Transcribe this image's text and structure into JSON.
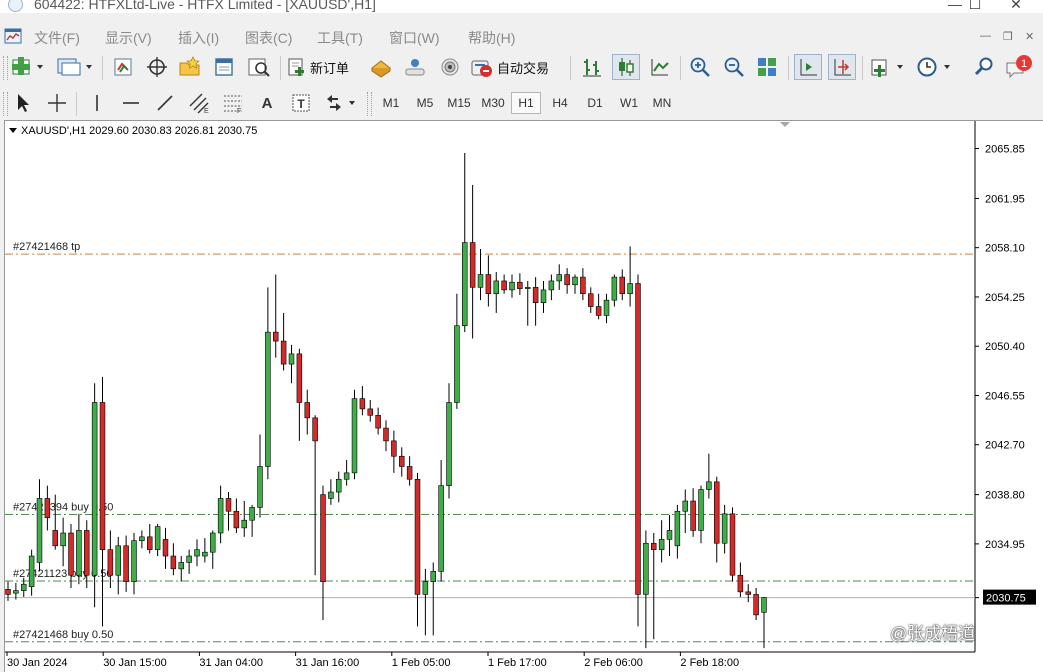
{
  "window": {
    "title": "604422: HTFXLtd-Live - HTFX Limited - [XAUUSD',H1]"
  },
  "menu": {
    "items": [
      "文件(F)",
      "显示(V)",
      "插入(I)",
      "图表(C)",
      "工具(T)",
      "窗口(W)",
      "帮助(H)"
    ]
  },
  "toolbar": {
    "new_order_label": "新订单",
    "auto_trading_label": "自动交易",
    "alerts_badge": "1"
  },
  "drawing_toolbar": {
    "text_tool": "A",
    "timeframes": [
      "M1",
      "M5",
      "M15",
      "M30",
      "H1",
      "H4",
      "D1",
      "W1",
      "MN"
    ],
    "active_timeframe": "H1"
  },
  "chart": {
    "header": "XAUUSD',H1  2029.60 2030.83 2026.81 2030.75",
    "current_price": "2030.75",
    "watermark": "@张成梧道",
    "colors": {
      "bull": "#3fae49",
      "bear": "#d42a2a",
      "trade_line": "#4b8f4b",
      "tp_line": "#d9813a",
      "bid_line": "#b0b0b0",
      "price_label_bg": "#000000"
    }
  },
  "chart_data": {
    "type": "candlestick",
    "symbol": "XAUUSD'",
    "timeframe": "H1",
    "ohlc_header": {
      "open": 2029.6,
      "high": 2030.83,
      "low": 2026.81,
      "close": 2030.75
    },
    "y_ticks": [
      2065.85,
      2061.95,
      2058.1,
      2054.25,
      2050.4,
      2046.55,
      2042.7,
      2038.8,
      2034.95,
      2030.75
    ],
    "ylim": [
      2026.5,
      2068.0
    ],
    "x_labels": [
      "30 Jan 2024",
      "30 Jan 15:00",
      "31 Jan 04:00",
      "31 Jan 16:00",
      "1 Feb 05:00",
      "1 Feb 17:00",
      "2 Feb 06:00",
      "2 Feb 18:00"
    ],
    "order_lines": [
      {
        "label": "#27421468 tp",
        "price": 2057.6,
        "style": "tp"
      },
      {
        "label": "#27421394 buy 0.50",
        "price": 2037.25,
        "style": "buy"
      },
      {
        "label": "#27421123 buy 0.50",
        "price": 2032.05,
        "style": "buy"
      },
      {
        "label": "#27421468 buy 0.50",
        "price": 2027.3,
        "style": "buy"
      }
    ],
    "candles": [
      {
        "o": 2031.4,
        "h": 2032.0,
        "l": 2030.5,
        "c": 2031.0
      },
      {
        "o": 2031.1,
        "h": 2031.9,
        "l": 2030.6,
        "c": 2031.3
      },
      {
        "o": 2031.3,
        "h": 2032.3,
        "l": 2030.8,
        "c": 2031.8
      },
      {
        "o": 2031.6,
        "h": 2034.5,
        "l": 2030.9,
        "c": 2034.0
      },
      {
        "o": 2033.5,
        "h": 2040.0,
        "l": 2032.8,
        "c": 2038.5
      },
      {
        "o": 2038.5,
        "h": 2039.5,
        "l": 2036.0,
        "c": 2037.0
      },
      {
        "o": 2036.0,
        "h": 2038.8,
        "l": 2034.5,
        "c": 2034.8
      },
      {
        "o": 2034.8,
        "h": 2037.0,
        "l": 2033.2,
        "c": 2035.8
      },
      {
        "o": 2035.8,
        "h": 2036.5,
        "l": 2031.5,
        "c": 2032.5
      },
      {
        "o": 2032.5,
        "h": 2037.3,
        "l": 2031.8,
        "c": 2036.0
      },
      {
        "o": 2036.0,
        "h": 2036.8,
        "l": 2031.5,
        "c": 2032.5
      },
      {
        "o": 2032.5,
        "h": 2047.5,
        "l": 2030.0,
        "c": 2046.0
      },
      {
        "o": 2046.0,
        "h": 2048.0,
        "l": 2028.5,
        "c": 2034.5
      },
      {
        "o": 2034.5,
        "h": 2036.0,
        "l": 2031.5,
        "c": 2032.5
      },
      {
        "o": 2032.5,
        "h": 2035.5,
        "l": 2031.0,
        "c": 2034.8
      },
      {
        "o": 2034.8,
        "h": 2035.6,
        "l": 2031.2,
        "c": 2032.0
      },
      {
        "o": 2032.0,
        "h": 2035.8,
        "l": 2031.0,
        "c": 2035.2
      },
      {
        "o": 2035.2,
        "h": 2036.0,
        "l": 2034.6,
        "c": 2035.5
      },
      {
        "o": 2035.5,
        "h": 2036.5,
        "l": 2034.2,
        "c": 2034.5
      },
      {
        "o": 2034.5,
        "h": 2036.5,
        "l": 2034.0,
        "c": 2036.3
      },
      {
        "o": 2035.3,
        "h": 2036.2,
        "l": 2033.0,
        "c": 2034.0
      },
      {
        "o": 2034.0,
        "h": 2035.0,
        "l": 2032.5,
        "c": 2033.0
      },
      {
        "o": 2033.0,
        "h": 2034.0,
        "l": 2032.0,
        "c": 2033.5
      },
      {
        "o": 2033.5,
        "h": 2034.5,
        "l": 2032.6,
        "c": 2034.0
      },
      {
        "o": 2034.0,
        "h": 2035.3,
        "l": 2033.2,
        "c": 2034.5
      },
      {
        "o": 2034.0,
        "h": 2035.4,
        "l": 2033.5,
        "c": 2034.3
      },
      {
        "o": 2034.3,
        "h": 2036.0,
        "l": 2033.0,
        "c": 2035.8
      },
      {
        "o": 2035.8,
        "h": 2039.5,
        "l": 2035.0,
        "c": 2038.5
      },
      {
        "o": 2038.5,
        "h": 2039.0,
        "l": 2036.0,
        "c": 2037.5
      },
      {
        "o": 2037.5,
        "h": 2038.5,
        "l": 2035.8,
        "c": 2036.2
      },
      {
        "o": 2036.2,
        "h": 2038.3,
        "l": 2035.5,
        "c": 2036.8
      },
      {
        "o": 2036.8,
        "h": 2038.0,
        "l": 2035.5,
        "c": 2037.8
      },
      {
        "o": 2037.8,
        "h": 2043.5,
        "l": 2037.0,
        "c": 2041.0
      },
      {
        "o": 2041.0,
        "h": 2055.0,
        "l": 2040.0,
        "c": 2051.5
      },
      {
        "o": 2051.5,
        "h": 2056.0,
        "l": 2049.5,
        "c": 2050.8
      },
      {
        "o": 2050.8,
        "h": 2053.0,
        "l": 2048.5,
        "c": 2049.0
      },
      {
        "o": 2049.0,
        "h": 2050.5,
        "l": 2047.5,
        "c": 2049.8
      },
      {
        "o": 2049.8,
        "h": 2050.2,
        "l": 2043.0,
        "c": 2046.0
      },
      {
        "o": 2046.0,
        "h": 2047.0,
        "l": 2043.5,
        "c": 2044.8
      },
      {
        "o": 2044.8,
        "h": 2045.0,
        "l": 2032.5,
        "c": 2043.0
      },
      {
        "o": 2038.8,
        "h": 2039.5,
        "l": 2029.0,
        "c": 2032.0
      },
      {
        "o": 2038.5,
        "h": 2040.0,
        "l": 2038.0,
        "c": 2039.0
      },
      {
        "o": 2039.0,
        "h": 2040.6,
        "l": 2038.2,
        "c": 2040.0
      },
      {
        "o": 2040.0,
        "h": 2041.5,
        "l": 2039.5,
        "c": 2040.5
      },
      {
        "o": 2040.5,
        "h": 2047.0,
        "l": 2040.0,
        "c": 2046.3
      },
      {
        "o": 2046.3,
        "h": 2047.3,
        "l": 2045.0,
        "c": 2045.5
      },
      {
        "o": 2045.5,
        "h": 2046.2,
        "l": 2044.5,
        "c": 2045.0
      },
      {
        "o": 2045.0,
        "h": 2045.6,
        "l": 2043.5,
        "c": 2044.0
      },
      {
        "o": 2044.0,
        "h": 2044.6,
        "l": 2042.2,
        "c": 2043.0
      },
      {
        "o": 2043.0,
        "h": 2043.8,
        "l": 2040.5,
        "c": 2041.8
      },
      {
        "o": 2041.8,
        "h": 2042.5,
        "l": 2040.2,
        "c": 2041.0
      },
      {
        "o": 2041.0,
        "h": 2041.8,
        "l": 2039.5,
        "c": 2040.0
      },
      {
        "o": 2040.0,
        "h": 2040.5,
        "l": 2028.5,
        "c": 2031.0
      },
      {
        "o": 2031.0,
        "h": 2033.0,
        "l": 2027.8,
        "c": 2032.0
      },
      {
        "o": 2032.0,
        "h": 2033.5,
        "l": 2027.8,
        "c": 2032.8
      },
      {
        "o": 2032.8,
        "h": 2041.5,
        "l": 2032.0,
        "c": 2039.5
      },
      {
        "o": 2039.5,
        "h": 2047.5,
        "l": 2038.5,
        "c": 2046.0
      },
      {
        "o": 2046.0,
        "h": 2054.5,
        "l": 2045.5,
        "c": 2052.0
      },
      {
        "o": 2052.0,
        "h": 2065.5,
        "l": 2051.5,
        "c": 2058.5
      },
      {
        "o": 2058.5,
        "h": 2063.0,
        "l": 2051.0,
        "c": 2055.0
      },
      {
        "o": 2055.0,
        "h": 2058.0,
        "l": 2054.0,
        "c": 2056.0
      },
      {
        "o": 2056.0,
        "h": 2057.5,
        "l": 2053.5,
        "c": 2054.5
      },
      {
        "o": 2054.5,
        "h": 2056.2,
        "l": 2053.0,
        "c": 2055.5
      },
      {
        "o": 2055.5,
        "h": 2056.0,
        "l": 2054.5,
        "c": 2054.8
      },
      {
        "o": 2054.8,
        "h": 2056.0,
        "l": 2054.2,
        "c": 2055.4
      },
      {
        "o": 2055.4,
        "h": 2056.1,
        "l": 2054.4,
        "c": 2054.9
      },
      {
        "o": 2054.9,
        "h": 2055.5,
        "l": 2052.0,
        "c": 2055.0
      },
      {
        "o": 2055.0,
        "h": 2055.8,
        "l": 2052.0,
        "c": 2053.8
      },
      {
        "o": 2053.8,
        "h": 2055.5,
        "l": 2053.0,
        "c": 2054.8
      },
      {
        "o": 2054.8,
        "h": 2056.0,
        "l": 2054.0,
        "c": 2055.5
      },
      {
        "o": 2055.5,
        "h": 2056.8,
        "l": 2054.8,
        "c": 2056.0
      },
      {
        "o": 2056.0,
        "h": 2056.5,
        "l": 2054.5,
        "c": 2055.2
      },
      {
        "o": 2055.2,
        "h": 2056.0,
        "l": 2054.5,
        "c": 2055.8
      },
      {
        "o": 2055.8,
        "h": 2056.5,
        "l": 2054.0,
        "c": 2054.5
      },
      {
        "o": 2054.5,
        "h": 2055.0,
        "l": 2053.0,
        "c": 2053.5
      },
      {
        "o": 2053.5,
        "h": 2054.5,
        "l": 2052.5,
        "c": 2052.8
      },
      {
        "o": 2052.8,
        "h": 2054.5,
        "l": 2052.2,
        "c": 2054.0
      },
      {
        "o": 2054.0,
        "h": 2056.0,
        "l": 2053.5,
        "c": 2055.8
      },
      {
        "o": 2055.8,
        "h": 2056.4,
        "l": 2054.0,
        "c": 2054.5
      },
      {
        "o": 2054.5,
        "h": 2058.2,
        "l": 2053.5,
        "c": 2055.3
      },
      {
        "o": 2055.3,
        "h": 2056.0,
        "l": 2028.5,
        "c": 2031.0
      },
      {
        "o": 2031.0,
        "h": 2036.0,
        "l": 2026.8,
        "c": 2035.0
      },
      {
        "o": 2035.0,
        "h": 2035.8,
        "l": 2027.5,
        "c": 2034.5
      },
      {
        "o": 2034.5,
        "h": 2036.8,
        "l": 2033.5,
        "c": 2035.3
      },
      {
        "o": 2035.3,
        "h": 2037.2,
        "l": 2034.0,
        "c": 2036.0
      },
      {
        "o": 2034.8,
        "h": 2038.0,
        "l": 2033.8,
        "c": 2037.5
      },
      {
        "o": 2037.5,
        "h": 2039.2,
        "l": 2035.8,
        "c": 2038.3
      },
      {
        "o": 2038.3,
        "h": 2039.3,
        "l": 2035.5,
        "c": 2036.0
      },
      {
        "o": 2036.0,
        "h": 2039.5,
        "l": 2035.0,
        "c": 2039.2
      },
      {
        "o": 2039.2,
        "h": 2042.0,
        "l": 2038.5,
        "c": 2039.8
      },
      {
        "o": 2039.8,
        "h": 2040.2,
        "l": 2033.5,
        "c": 2035.0
      },
      {
        "o": 2035.0,
        "h": 2038.0,
        "l": 2034.2,
        "c": 2037.3
      },
      {
        "o": 2037.3,
        "h": 2037.8,
        "l": 2032.0,
        "c": 2032.5
      },
      {
        "o": 2032.5,
        "h": 2033.5,
        "l": 2030.8,
        "c": 2031.2
      },
      {
        "o": 2031.2,
        "h": 2031.8,
        "l": 2030.4,
        "c": 2031.0
      },
      {
        "o": 2031.0,
        "h": 2031.5,
        "l": 2029.0,
        "c": 2029.4
      },
      {
        "o": 2029.6,
        "h": 2030.8,
        "l": 2026.8,
        "c": 2030.75
      }
    ]
  }
}
